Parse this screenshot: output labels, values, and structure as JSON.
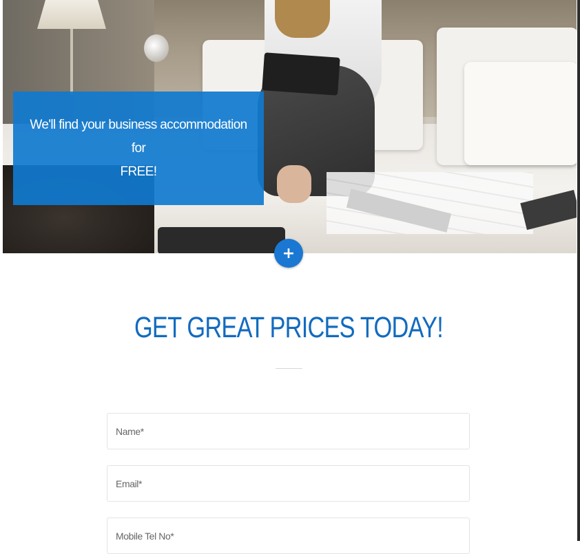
{
  "hero": {
    "promo_text": "We'll find your business accommodation\nfor\nFREE!",
    "expand_label": "+"
  },
  "form": {
    "heading": "GET GREAT PRICES TODAY!",
    "name_placeholder": "Name*",
    "email_placeholder": "Email*",
    "mobile_placeholder": "Mobile Tel No*"
  },
  "colors": {
    "accent": "#1a78d2",
    "heading": "#126bbf",
    "promo_bg": "#107acf"
  },
  "icons": {
    "expand": "plus-icon"
  }
}
